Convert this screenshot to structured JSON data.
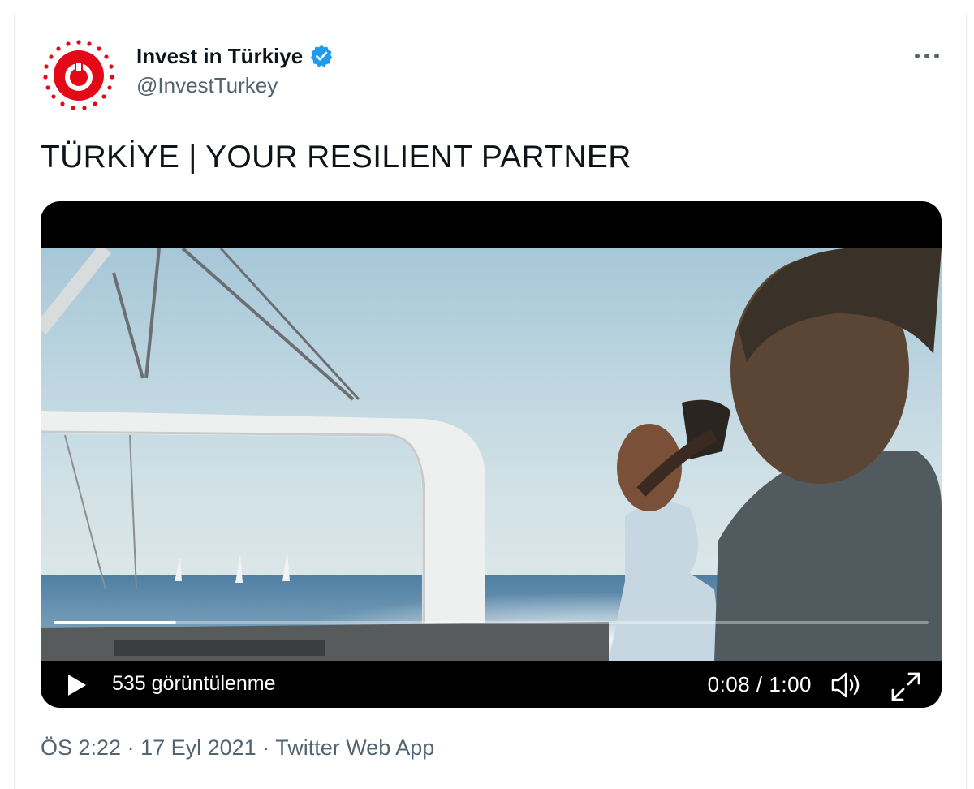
{
  "tweet": {
    "author": {
      "display_name": "Invest in Türkiye",
      "handle": "@InvestTurkey",
      "verified_icon": "verified-badge-icon",
      "avatar_icon": "invest-in-turkiye-logo"
    },
    "more_icon": "more-horizontal-icon",
    "text": "TÜRKİYE | YOUR RESILIENT PARTNER",
    "video": {
      "view_count": "535 görüntülenme",
      "time": "0:08 / 1:00",
      "progress": 0.14,
      "play_icon": "play-icon",
      "volume_icon": "volume-icon",
      "fullscreen_icon": "fullscreen-icon"
    },
    "meta": {
      "time": "ÖS 2:22",
      "separator": " · ",
      "date": "17 Eyl 2021",
      "source": "Twitter Web App"
    }
  },
  "colors": {
    "brand_red": "#e30a17",
    "verified_blue": "#1d9bf0",
    "secondary_text": "#536471"
  }
}
